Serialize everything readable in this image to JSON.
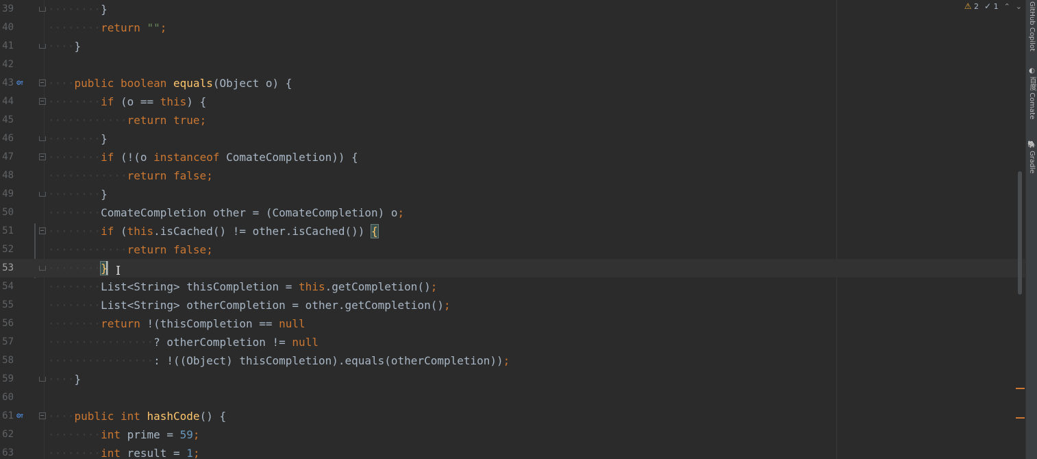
{
  "editor": {
    "lines": [
      {
        "num": "39",
        "fold": "close",
        "indent": 2,
        "tokens": [
          {
            "t": "}",
            "c": "plain"
          }
        ]
      },
      {
        "num": "40",
        "fold": "",
        "indent": 2,
        "tokens": [
          {
            "t": "return ",
            "c": "kw"
          },
          {
            "t": "\"\"",
            "c": "str"
          },
          {
            "t": ";",
            "c": "punc"
          }
        ]
      },
      {
        "num": "41",
        "fold": "close",
        "indent": 1,
        "tokens": [
          {
            "t": "}",
            "c": "plain"
          }
        ]
      },
      {
        "num": "42",
        "fold": "",
        "indent": 0,
        "tokens": []
      },
      {
        "num": "43",
        "fold": "open",
        "icon": "⚙↑",
        "indent": 1,
        "tokens": [
          {
            "t": "public boolean ",
            "c": "kw"
          },
          {
            "t": "equals",
            "c": "fn"
          },
          {
            "t": "(Object o) {",
            "c": "plain"
          }
        ]
      },
      {
        "num": "44",
        "fold": "open",
        "indent": 2,
        "tokens": [
          {
            "t": "if ",
            "c": "kw"
          },
          {
            "t": "(o == ",
            "c": "plain"
          },
          {
            "t": "this",
            "c": "kw"
          },
          {
            "t": ") {",
            "c": "plain"
          }
        ]
      },
      {
        "num": "45",
        "fold": "",
        "indent": 3,
        "tokens": [
          {
            "t": "return true",
            "c": "kw"
          },
          {
            "t": ";",
            "c": "punc"
          }
        ]
      },
      {
        "num": "46",
        "fold": "close",
        "indent": 2,
        "tokens": [
          {
            "t": "}",
            "c": "plain"
          }
        ]
      },
      {
        "num": "47",
        "fold": "open",
        "indent": 2,
        "tokens": [
          {
            "t": "if ",
            "c": "kw"
          },
          {
            "t": "(!(o ",
            "c": "plain"
          },
          {
            "t": "instanceof ",
            "c": "kw"
          },
          {
            "t": "ComateCompletion)) {",
            "c": "plain"
          }
        ]
      },
      {
        "num": "48",
        "fold": "",
        "indent": 3,
        "tokens": [
          {
            "t": "return false",
            "c": "kw"
          },
          {
            "t": ";",
            "c": "punc"
          }
        ]
      },
      {
        "num": "49",
        "fold": "close",
        "indent": 2,
        "tokens": [
          {
            "t": "}",
            "c": "plain"
          }
        ]
      },
      {
        "num": "50",
        "fold": "",
        "indent": 2,
        "tokens": [
          {
            "t": "ComateCompletion other = (ComateCompletion) o",
            "c": "plain"
          },
          {
            "t": ";",
            "c": "punc"
          }
        ]
      },
      {
        "num": "51",
        "fold": "open",
        "indent": 2,
        "tokens": [
          {
            "t": "if ",
            "c": "kw"
          },
          {
            "t": "(",
            "c": "plain"
          },
          {
            "t": "this",
            "c": "kw"
          },
          {
            "t": ".isCached() != other.isCached()) ",
            "c": "plain"
          },
          {
            "t": "{",
            "c": "brace-hl"
          }
        ]
      },
      {
        "num": "52",
        "fold": "",
        "indent": 3,
        "tokens": [
          {
            "t": "return false",
            "c": "kw"
          },
          {
            "t": ";",
            "c": "punc"
          }
        ]
      },
      {
        "num": "53",
        "fold": "close",
        "indent": 2,
        "current": true,
        "tokens": [
          {
            "t": "}",
            "c": "brace-hl"
          }
        ]
      },
      {
        "num": "54",
        "fold": "",
        "indent": 2,
        "tokens": [
          {
            "t": "List<String> thisCompletion = ",
            "c": "plain"
          },
          {
            "t": "this",
            "c": "kw"
          },
          {
            "t": ".getCompletion()",
            "c": "plain"
          },
          {
            "t": ";",
            "c": "punc"
          }
        ]
      },
      {
        "num": "55",
        "fold": "",
        "indent": 2,
        "tokens": [
          {
            "t": "List<String> otherCompletion = other.getCompletion()",
            "c": "plain"
          },
          {
            "t": ";",
            "c": "punc"
          }
        ]
      },
      {
        "num": "56",
        "fold": "",
        "indent": 2,
        "tokens": [
          {
            "t": "return ",
            "c": "kw"
          },
          {
            "t": "!(thisCompletion == ",
            "c": "plain"
          },
          {
            "t": "null",
            "c": "kw"
          }
        ]
      },
      {
        "num": "57",
        "fold": "",
        "indent": 4,
        "tokens": [
          {
            "t": "? otherCompletion != ",
            "c": "plain"
          },
          {
            "t": "null",
            "c": "kw"
          }
        ]
      },
      {
        "num": "58",
        "fold": "",
        "indent": 4,
        "tokens": [
          {
            "t": ": !((Object) thisCompletion).equals(otherCompletion))",
            "c": "plain"
          },
          {
            "t": ";",
            "c": "punc"
          }
        ]
      },
      {
        "num": "59",
        "fold": "close",
        "indent": 1,
        "tokens": [
          {
            "t": "}",
            "c": "plain"
          }
        ]
      },
      {
        "num": "60",
        "fold": "",
        "indent": 0,
        "tokens": []
      },
      {
        "num": "61",
        "fold": "open",
        "icon": "⚙↑",
        "indent": 1,
        "tokens": [
          {
            "t": "public int ",
            "c": "kw"
          },
          {
            "t": "hashCode",
            "c": "fn"
          },
          {
            "t": "() {",
            "c": "plain"
          }
        ]
      },
      {
        "num": "62",
        "fold": "",
        "indent": 2,
        "tokens": [
          {
            "t": "int ",
            "c": "kw"
          },
          {
            "t": "prime = ",
            "c": "plain"
          },
          {
            "t": "59",
            "c": "num"
          },
          {
            "t": ";",
            "c": "punc"
          }
        ]
      },
      {
        "num": "63",
        "fold": "",
        "indent": 2,
        "tokens": [
          {
            "t": "int ",
            "c": "kw"
          },
          {
            "t": "result = ",
            "c": "plain"
          },
          {
            "t": "1",
            "c": "num"
          },
          {
            "t": ";",
            "c": "punc"
          }
        ]
      }
    ]
  },
  "inspection": {
    "warnings": "2",
    "weak_warnings": "1",
    "warn_icon": "warning-triangle-icon",
    "weak_icon": "weak-warning-check-icon"
  },
  "tool_strip": [
    {
      "label": "GitHub Copilot",
      "icon": "copilot-icon"
    },
    {
      "label": "百度 Comate",
      "icon": "comate-icon"
    },
    {
      "label": "Gradle",
      "icon": "gradle-elephant-icon"
    }
  ],
  "colors": {
    "background": "#2b2b2b",
    "keyword": "#cc7832",
    "function": "#ffc66d",
    "number": "#6897bb",
    "string": "#6a8759",
    "text": "#a9b7c6"
  }
}
